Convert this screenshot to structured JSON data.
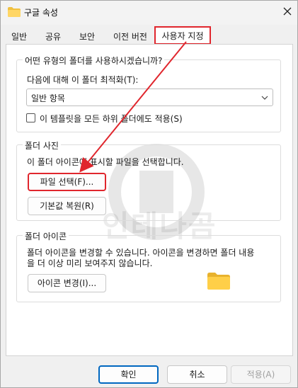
{
  "window": {
    "title": "구글 속성",
    "accent_color": "#e0262d"
  },
  "tabs": [
    {
      "label": "일반",
      "active": false
    },
    {
      "label": "공유",
      "active": false
    },
    {
      "label": "보안",
      "active": false
    },
    {
      "label": "이전 버전",
      "active": false
    },
    {
      "label": "사용자 지정",
      "active": true
    }
  ],
  "folder_type": {
    "group_label": "어떤 유형의 폴더를 사용하시겠습니까?",
    "optimize_label": "다음에 대해 이 폴더 최적화(T):",
    "selected": "일반 항목",
    "apply_subfolders_label": "이 템플릿을 모든 하위 폴더에도 적용(S)",
    "apply_subfolders_checked": false
  },
  "folder_pictures": {
    "group_label": "폴더 사진",
    "description": "이 폴더 아이콘에 표시할 파일을 선택합니다.",
    "choose_file_label": "파일 선택(F)...",
    "restore_default_label": "기본값 복원(R)"
  },
  "folder_icons": {
    "group_label": "폴더 아이콘",
    "description_line1": "폴더 아이콘을 변경할 수 있습니다. 아이콘을 변경하면 폴더 내용",
    "description_line2": "을 더 이상  미리 보여주지 않습니다.",
    "change_icon_label": "아이콘 변경(I)..."
  },
  "footer": {
    "ok_label": "확인",
    "cancel_label": "취소",
    "apply_label": "적용(A)"
  },
  "watermark": {
    "text": "인테나곰"
  }
}
